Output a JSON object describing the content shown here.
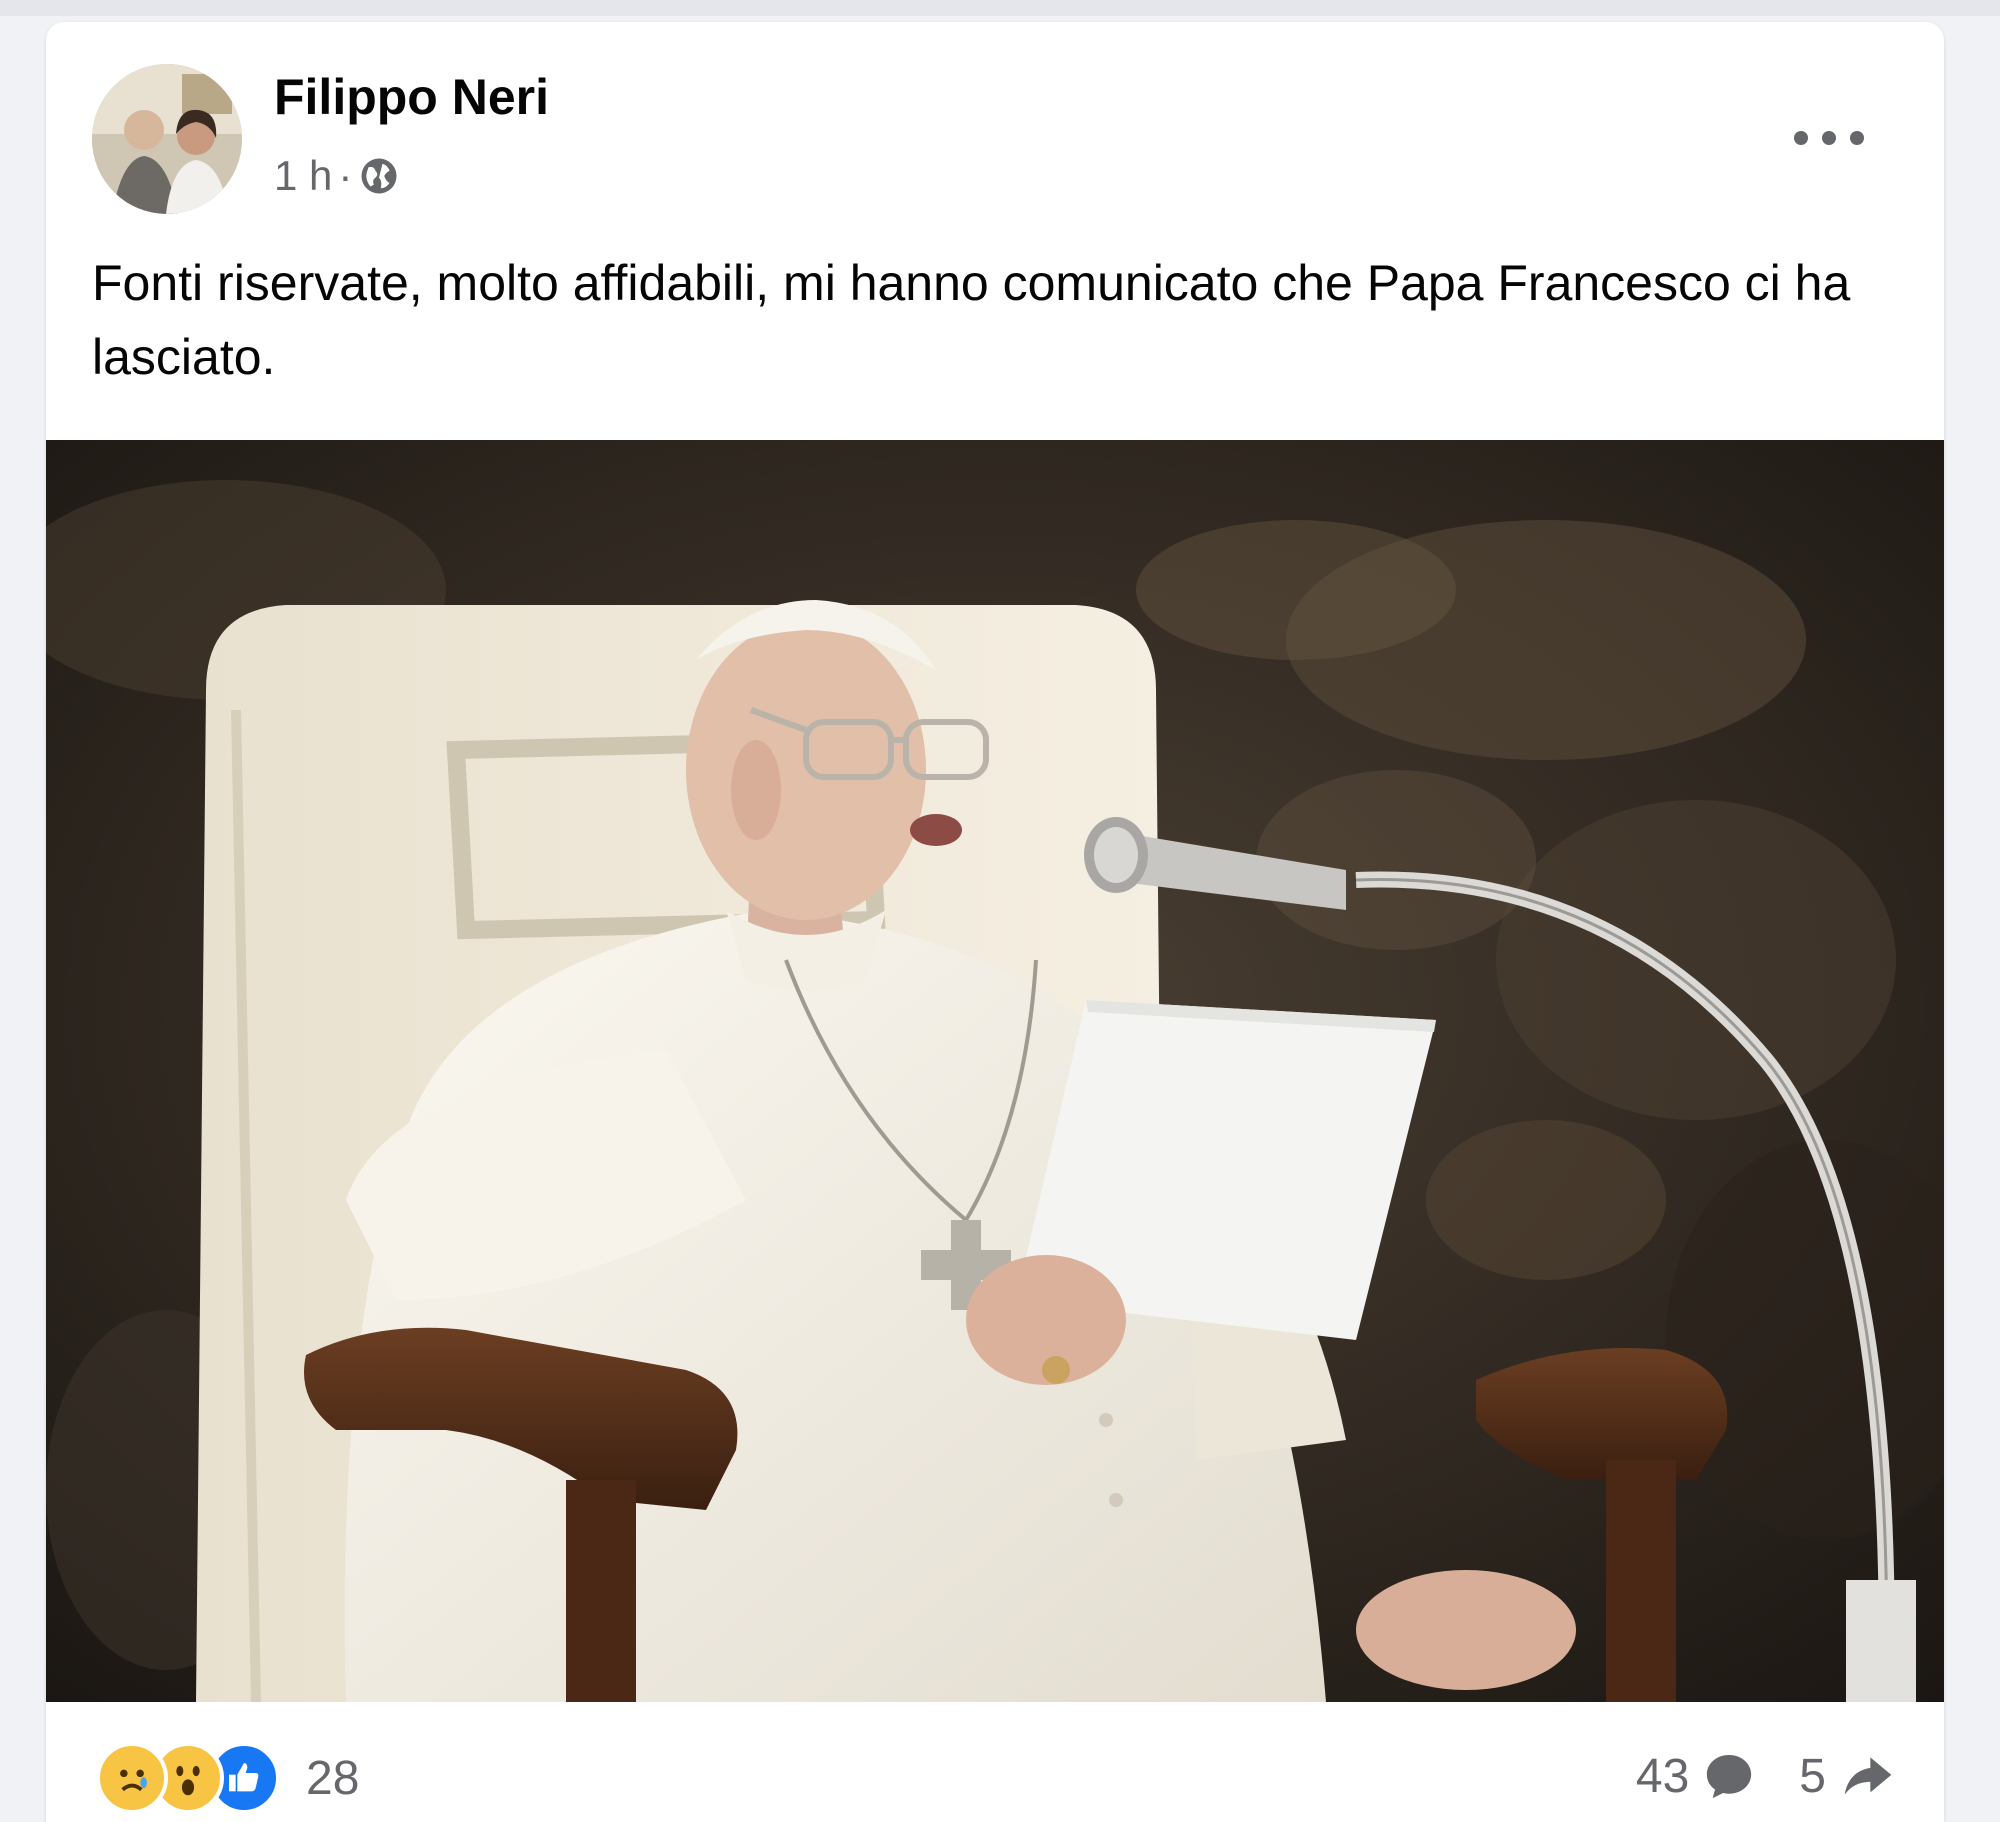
{
  "post": {
    "author": "Filippo Neri",
    "time": "1 h",
    "separator": "·",
    "audience_icon": "globe-icon",
    "more_icon": "more-options-icon",
    "text": "Fonti riservate, molto affidabili, mi hanno comunicato che Papa Francesco ci ha lasciato."
  },
  "footer": {
    "reactions": [
      "sad-reaction-icon",
      "wow-reaction-icon",
      "like-reaction-icon"
    ],
    "reaction_count": "28",
    "comment_count": "43",
    "comment_icon": "comment-icon",
    "share_count": "5",
    "share_icon": "share-icon"
  },
  "colors": {
    "background": "#f0f2f5",
    "card": "#ffffff",
    "text_primary": "#050505",
    "text_secondary": "#65676b",
    "like_blue": "#1877f2",
    "reaction_yellow": "#f7c444"
  }
}
